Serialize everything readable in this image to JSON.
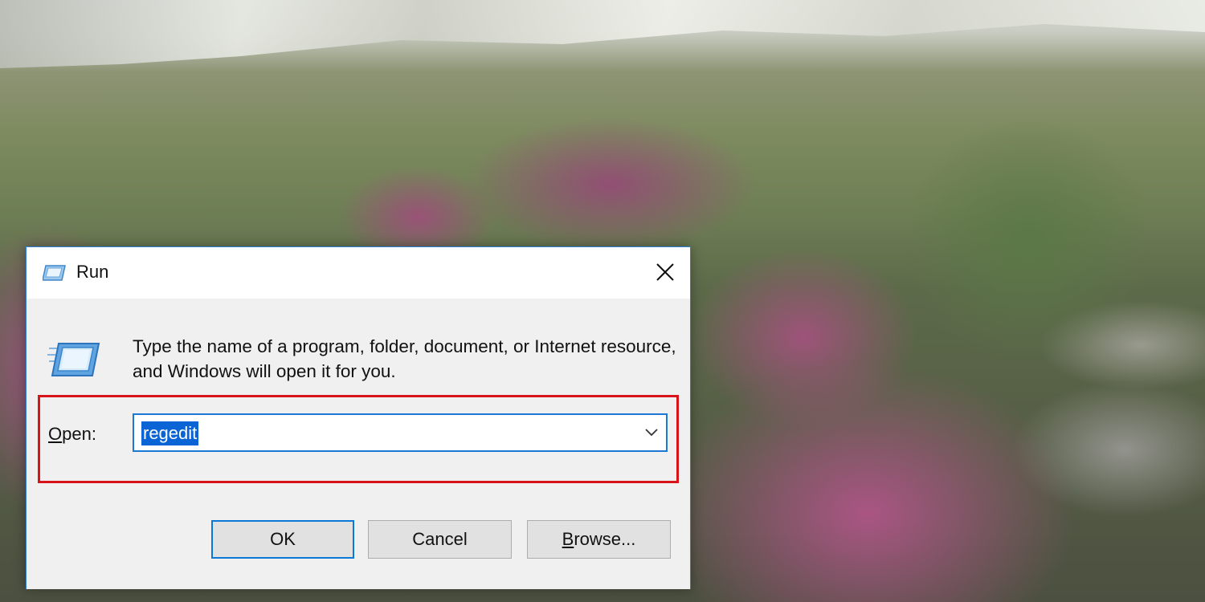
{
  "dialog": {
    "title": "Run",
    "description": "Type the name of a program, folder, document, or Internet resource, and Windows will open it for you.",
    "open_label_accel": "O",
    "open_label_rest": "pen:",
    "open_value": "regedit",
    "buttons": {
      "ok": "OK",
      "cancel": "Cancel",
      "browse_accel": "B",
      "browse_rest": "rowse..."
    },
    "icons": {
      "title": "run-icon",
      "main": "run-icon",
      "close": "close-icon",
      "dropdown": "chevron-down-icon"
    }
  },
  "colors": {
    "accent": "#0a78d7",
    "highlight_box": "#d8141a",
    "selection": "#0a64d6"
  }
}
